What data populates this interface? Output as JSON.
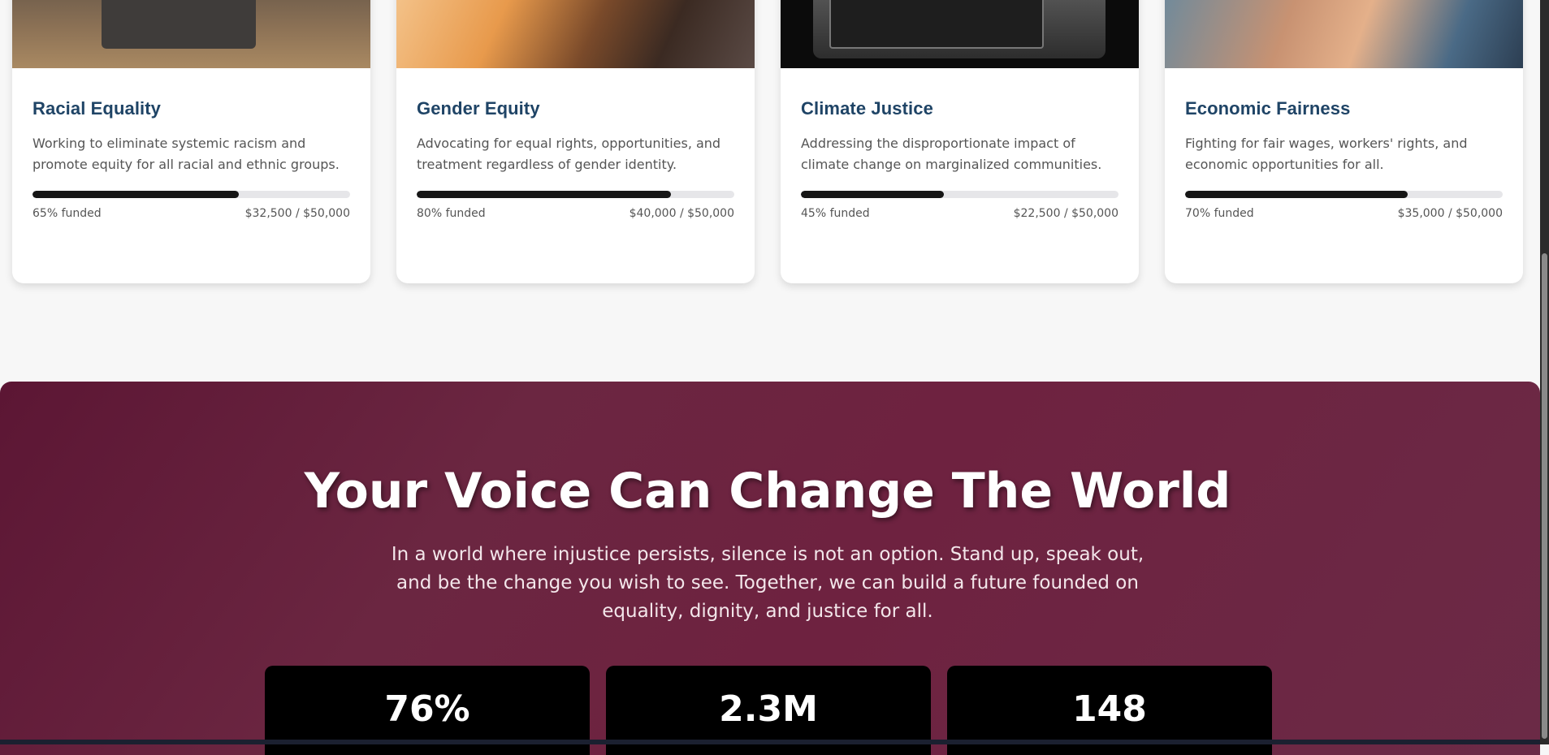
{
  "causes": [
    {
      "title": "Racial Equality",
      "description": "Working to eliminate systemic racism and promote equity for all racial and ethnic groups.",
      "funded_label": "65% funded",
      "funded_fraction": 0.65,
      "amount": "$32,500 / $50,000"
    },
    {
      "title": "Gender Equity",
      "description": "Advocating for equal rights, opportunities, and treatment regardless of gender identity.",
      "funded_label": "80% funded",
      "funded_fraction": 0.8,
      "amount": "$40,000 / $50,000"
    },
    {
      "title": "Climate Justice",
      "description": "Addressing the disproportionate impact of climate change on marginalized communities.",
      "funded_label": "45% funded",
      "funded_fraction": 0.45,
      "amount": "$22,500 / $50,000"
    },
    {
      "title": "Economic Fairness",
      "description": "Fighting for fair wages, workers' rights, and economic opportunities for all.",
      "funded_label": "70% funded",
      "funded_fraction": 0.7,
      "amount": "$35,000 / $50,000"
    }
  ],
  "cta": {
    "title": "Your Voice Can Change The World",
    "text": "In a world where injustice persists, silence is not an option. Stand up, speak out, and be the change you wish to see. Together, we can build a future founded on equality, dignity, and justice for all."
  },
  "stats": [
    {
      "value": "76%"
    },
    {
      "value": "2.3M"
    },
    {
      "value": "148"
    }
  ],
  "colors": {
    "title": "#1f4466",
    "progress_fill": "#161616",
    "progress_track": "#e6e6e9",
    "cta_bg": "#6b2641"
  }
}
